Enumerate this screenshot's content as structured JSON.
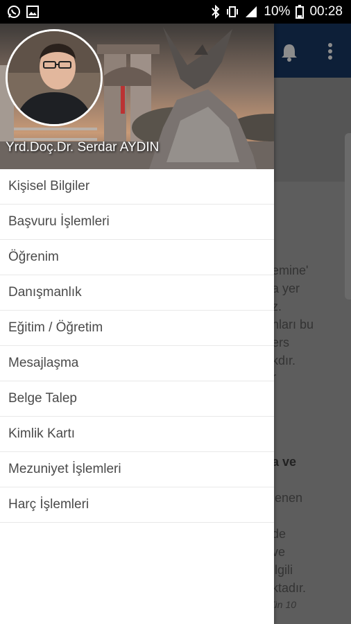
{
  "status_bar": {
    "left_icons": [
      "whatsapp-icon",
      "image-icon"
    ],
    "right_icons": [
      "bluetooth-icon",
      "vibrate-icon",
      "signal-icon"
    ],
    "battery": "10%",
    "time": "00:28"
  },
  "app": {
    "appbar_color": "#0d1f38",
    "appbar_icons": [
      "bell-icon",
      "more-vert-icon"
    ],
    "background_text": [
      "emine'",
      "a yer",
      "z.",
      "nları bu",
      "ers",
      "kdır.",
      "r",
      "a ve",
      "lenen",
      "de",
      "ve",
      "ilgili",
      "ktadır.",
      "ün 10"
    ]
  },
  "drawer": {
    "user_name": "Yrd.Doç.Dr. Serdar AYDIN",
    "menu": [
      {
        "label": "Kişisel Bilgiler"
      },
      {
        "label": "Başvuru İşlemleri"
      },
      {
        "label": "Öğrenim"
      },
      {
        "label": "Danışmanlık"
      },
      {
        "label": "Eğitim / Öğretim"
      },
      {
        "label": "Mesajlaşma"
      },
      {
        "label": "Belge Talep"
      },
      {
        "label": "Kimlik Kartı"
      },
      {
        "label": "Mezuniyet İşlemleri"
      },
      {
        "label": "Harç İşlemleri"
      }
    ]
  }
}
